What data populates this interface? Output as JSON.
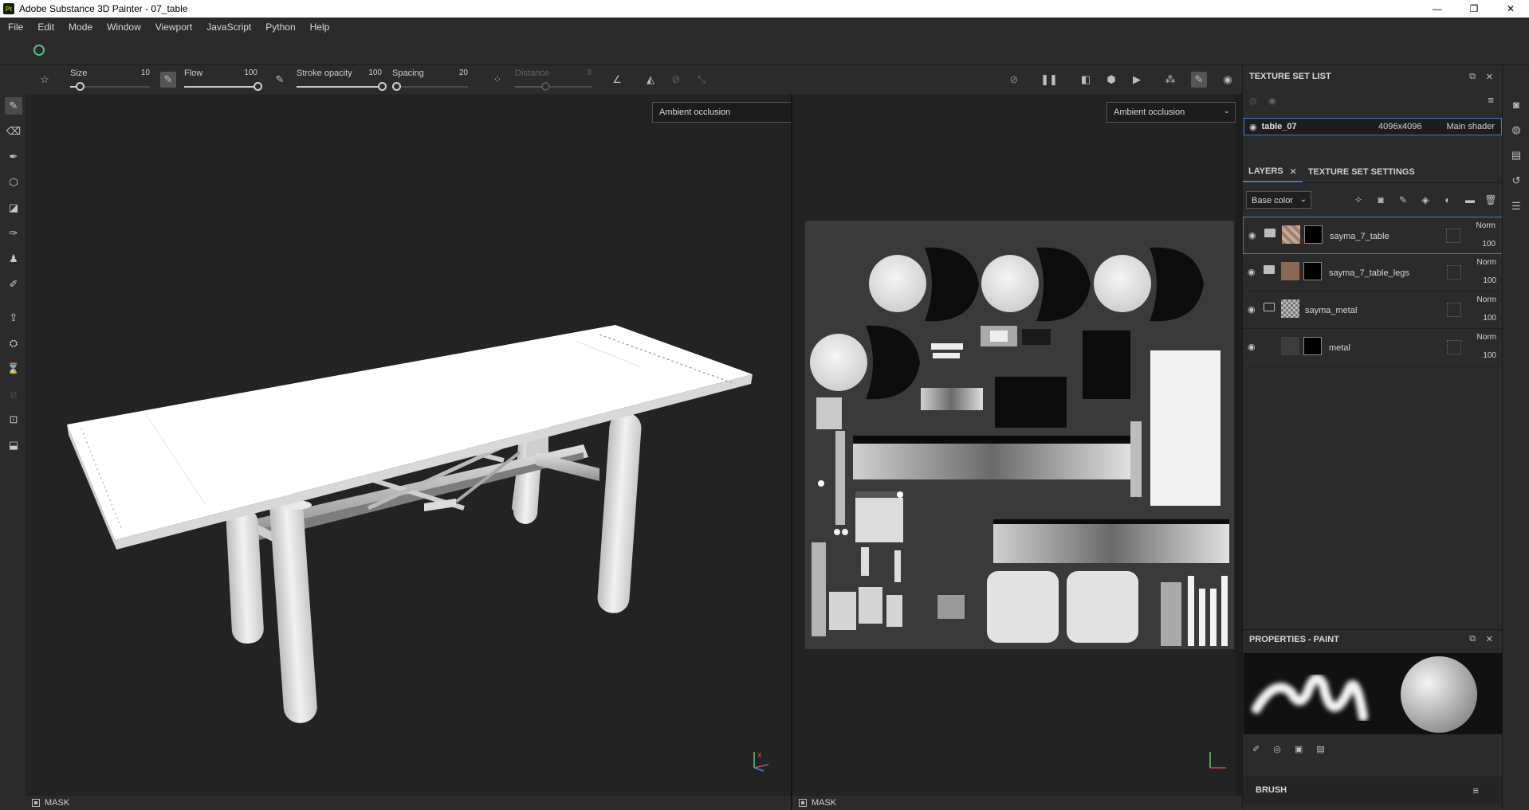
{
  "app": {
    "title": "Adobe Substance 3D Painter - 07_table",
    "icon_text": "Pt"
  },
  "window_controls": {
    "minimize": "—",
    "maximize": "❐",
    "close": "✕"
  },
  "menu": [
    "File",
    "Edit",
    "Mode",
    "Window",
    "Viewport",
    "JavaScript",
    "Python",
    "Help"
  ],
  "toolbar": {
    "size": {
      "label": "Size",
      "value": "10",
      "level": 0.12
    },
    "flow": {
      "label": "Flow",
      "value": "100",
      "level": 1.0
    },
    "stroke_opacity": {
      "label": "Stroke opacity",
      "value": "100",
      "level": 1.0
    },
    "spacing": {
      "label": "Spacing",
      "value": "20",
      "level": 0.05
    },
    "distance": {
      "label": "Distance",
      "value": "8",
      "level": 0.4
    }
  },
  "viewport3d": {
    "channel": "Ambient occlusion",
    "mask_label": "MASK"
  },
  "viewport2d": {
    "channel": "Ambient occlusion",
    "mask_label": "MASK"
  },
  "texture_set_list": {
    "title": "TEXTURE SET LIST",
    "set": {
      "name": "table_07",
      "resolution": "4096x4096",
      "shader": "Main shader"
    }
  },
  "layers_panel": {
    "tab_layers": "LAYERS",
    "tab_settings": "TEXTURE SET SETTINGS",
    "channel": "Base color",
    "layers": [
      {
        "name": "sayma_7_table",
        "blend": "Norm",
        "opacity": "100"
      },
      {
        "name": "sayma_7_table_legs",
        "blend": "Norm",
        "opacity": "100"
      },
      {
        "name": "sayma_metal",
        "blend": "Norm",
        "opacity": "100"
      },
      {
        "name": "metal",
        "blend": "Norm",
        "opacity": "100"
      }
    ]
  },
  "properties": {
    "title": "PROPERTIES - PAINT",
    "brush_label": "BRUSH"
  },
  "colors": {
    "accent": "#3b7fc4",
    "panel": "#2b2b2b",
    "viewport": "#232323"
  }
}
